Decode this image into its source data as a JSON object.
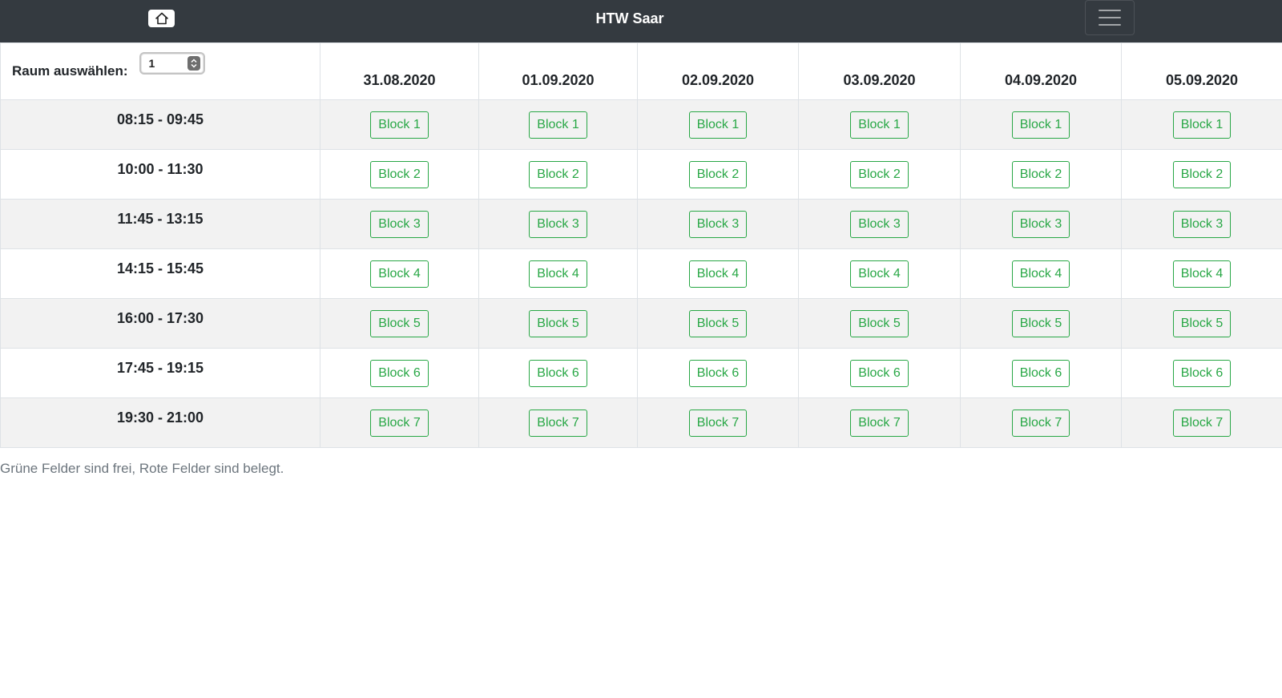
{
  "navbar": {
    "home_icon": "home-icon",
    "brand": "HTW Saar",
    "menu_icon": "hamburger-menu-icon"
  },
  "room": {
    "label": "Raum auswählen:",
    "value": "1"
  },
  "dates": [
    "31.08.2020",
    "01.09.2020",
    "02.09.2020",
    "03.09.2020",
    "04.09.2020",
    "05.09.2020"
  ],
  "time_slots": [
    "08:15 - 09:45",
    "10:00 - 11:30",
    "11:45 - 13:15",
    "14:15 - 15:45",
    "16:00 - 17:30",
    "17:45 - 19:15",
    "19:30 - 21:00"
  ],
  "blocks": [
    "Block 1",
    "Block 2",
    "Block 3",
    "Block 4",
    "Block 5",
    "Block 6",
    "Block 7"
  ],
  "legend": "Grüne Felder sind frei, Rote Felder sind belegt.",
  "colors": {
    "navbar": "#343a40",
    "free": "#28a745",
    "stripe": "#f2f2f2"
  }
}
